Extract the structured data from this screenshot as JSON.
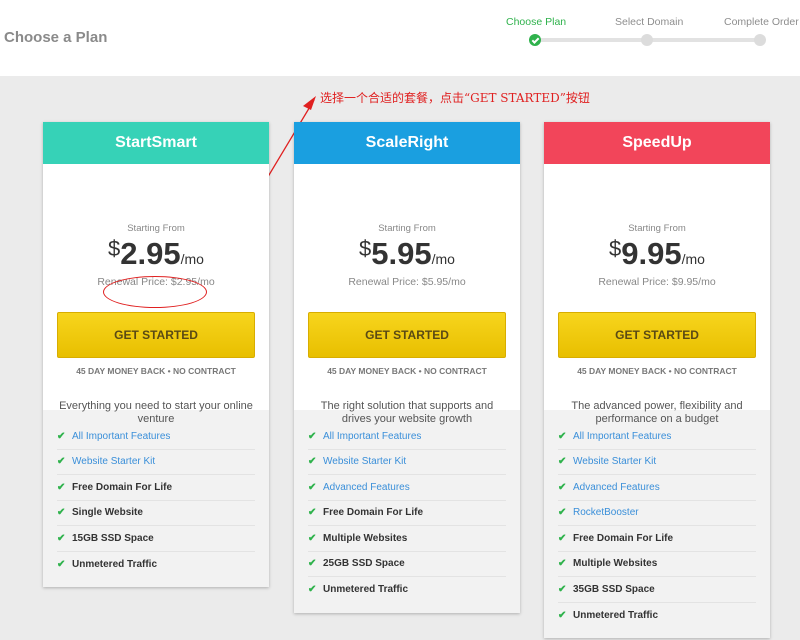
{
  "page_title": "Choose a Plan",
  "steps": [
    {
      "label": "Choose Plan",
      "active": true
    },
    {
      "label": "Select Domain",
      "active": false
    },
    {
      "label": "Complete Order",
      "active": false
    }
  ],
  "annotation": "选择一个合适的套餐，点击“GET STARTED”按钮",
  "colors": {
    "accent": "#2fb24c",
    "link": "#3a8fd9",
    "annotation": "#e02020"
  },
  "icons": {
    "feature_check": "check-icon",
    "step_done": "check-icon"
  },
  "plans": [
    {
      "name": "StartSmart",
      "color": "#36d2b7",
      "starting_from": "Starting From",
      "currency": "$",
      "price": "2.95",
      "per": "/mo",
      "renewal": "Renewal Price: $2.95/mo",
      "cta": "GET STARTED",
      "guarantee": "45 DAY MONEY BACK • NO CONTRACT",
      "tagline": "Everything you need to start your online venture",
      "features": [
        {
          "text": "All Important Features",
          "style": "link"
        },
        {
          "text": "Website Starter Kit",
          "style": "link"
        },
        {
          "text": "Free Domain For Life",
          "style": "bold"
        },
        {
          "text": "Single Website",
          "style": "bold"
        },
        {
          "text": "15GB SSD Space",
          "style": "bold"
        },
        {
          "text": "Unmetered Traffic",
          "style": "bold"
        }
      ]
    },
    {
      "name": "ScaleRight",
      "color": "#1a9fe0",
      "starting_from": "Starting From",
      "currency": "$",
      "price": "5.95",
      "per": "/mo",
      "renewal": "Renewal Price: $5.95/mo",
      "cta": "GET STARTED",
      "guarantee": "45 DAY MONEY BACK • NO CONTRACT",
      "tagline": "The right solution that supports and drives your website growth",
      "features": [
        {
          "text": "All Important Features",
          "style": "link"
        },
        {
          "text": "Website Starter Kit",
          "style": "link"
        },
        {
          "text": "Advanced Features",
          "style": "link"
        },
        {
          "text": "Free Domain For Life",
          "style": "bold"
        },
        {
          "text": "Multiple Websites",
          "style": "bold"
        },
        {
          "text": "25GB SSD Space",
          "style": "bold"
        },
        {
          "text": "Unmetered Traffic",
          "style": "bold"
        }
      ]
    },
    {
      "name": "SpeedUp",
      "color": "#f2455a",
      "starting_from": "Starting From",
      "currency": "$",
      "price": "9.95",
      "per": "/mo",
      "renewal": "Renewal Price: $9.95/mo",
      "cta": "GET STARTED",
      "guarantee": "45 DAY MONEY BACK • NO CONTRACT",
      "tagline": "The advanced power, flexibility and performance on a budget",
      "features": [
        {
          "text": "All Important Features",
          "style": "link"
        },
        {
          "text": "Website Starter Kit",
          "style": "link"
        },
        {
          "text": "Advanced Features",
          "style": "link"
        },
        {
          "text": "RocketBooster",
          "style": "link"
        },
        {
          "text": "Free Domain For Life",
          "style": "bold"
        },
        {
          "text": "Multiple Websites",
          "style": "bold"
        },
        {
          "text": "35GB SSD Space",
          "style": "bold"
        },
        {
          "text": "Unmetered Traffic",
          "style": "bold"
        }
      ]
    }
  ]
}
